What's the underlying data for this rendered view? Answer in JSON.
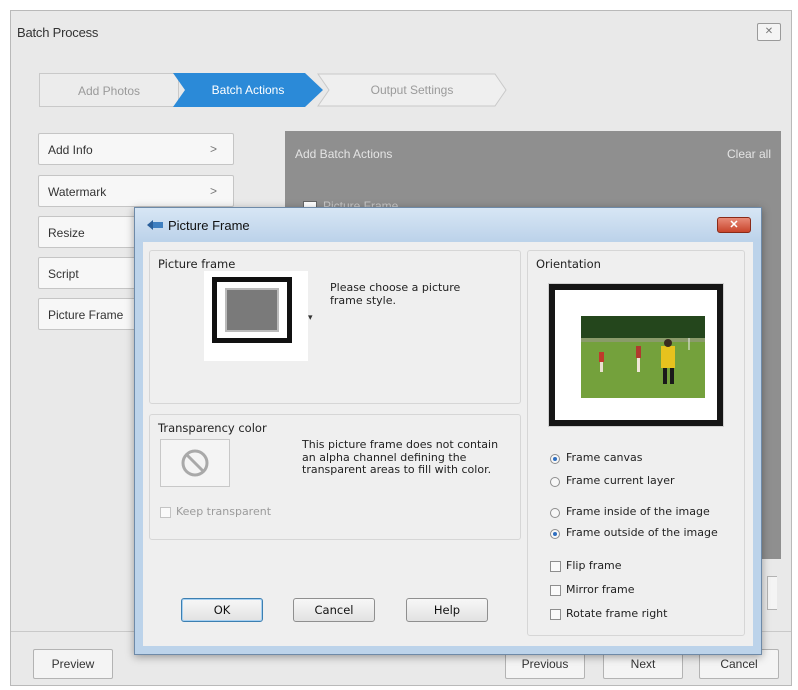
{
  "batch_window": {
    "title": "Batch Process",
    "close_glyph": "✕",
    "wizard_steps": [
      "Add Photos",
      "Batch Actions",
      "Output Settings"
    ],
    "active_step": "Batch Actions",
    "side_actions": [
      {
        "label": "Add Info",
        "chevron": ">"
      },
      {
        "label": "Watermark",
        "chevron": ">"
      },
      {
        "label": "Resize",
        "chevron": ">"
      },
      {
        "label": "Script",
        "chevron": ""
      },
      {
        "label": "Picture Frame",
        "chevron": ""
      }
    ],
    "actions_panel": {
      "title": "Add Batch Actions",
      "clear_all": "Clear all",
      "item": "Picture Frame"
    },
    "footer": {
      "preview": "Preview",
      "previous": "Previous",
      "next": "Next",
      "cancel": "Cancel"
    }
  },
  "dialog": {
    "title": "Picture Frame",
    "close_glyph": "✕",
    "picture_frame": {
      "title": "Picture frame",
      "hint": "Please choose a picture frame style.",
      "dropdown_caret": "▾"
    },
    "transparency": {
      "title": "Transparency color",
      "no_color_icon": "no-symbol-icon",
      "description": "This picture frame does not contain an alpha channel defining the transparent areas to fill with color.",
      "keep_transparent": {
        "label": "Keep transparent",
        "checked": false,
        "enabled": false
      }
    },
    "orientation": {
      "title": "Orientation",
      "canvas_group": [
        {
          "label": "Frame canvas",
          "selected": true
        },
        {
          "label": "Frame current layer",
          "selected": false
        }
      ],
      "position_group": [
        {
          "label": "Frame inside of the image",
          "selected": false
        },
        {
          "label": "Frame outside of the image",
          "selected": true
        }
      ],
      "checkboxes": [
        {
          "label": "Flip frame",
          "checked": false
        },
        {
          "label": "Mirror frame",
          "checked": false
        },
        {
          "label": "Rotate frame right",
          "checked": false
        }
      ]
    },
    "buttons": {
      "ok": "OK",
      "cancel": "Cancel",
      "help": "Help"
    },
    "colors": {
      "accent": "#2b8ad8",
      "close_red": "#c8452c",
      "dialog_frame": "#bcd3ea"
    }
  }
}
